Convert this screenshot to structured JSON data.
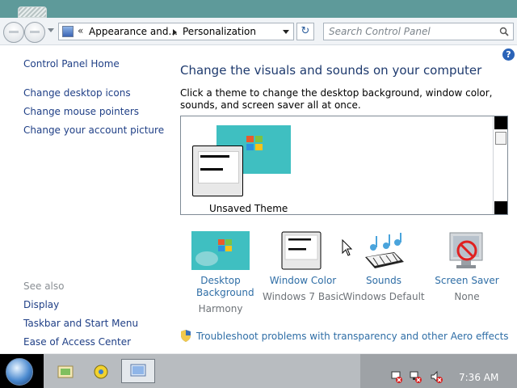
{
  "nav": {
    "breadcrumb_prefix": "«",
    "breadcrumb_1": "Appearance and...",
    "breadcrumb_2": "Personalization",
    "search_placeholder": "Search Control Panel",
    "refresh_glyph": "↻"
  },
  "help": {
    "glyph": "?"
  },
  "sidebar": {
    "home": "Control Panel Home",
    "links": [
      "Change desktop icons",
      "Change mouse pointers",
      "Change your account picture"
    ],
    "see_also_label": "See also",
    "see_also": [
      "Display",
      "Taskbar and Start Menu",
      "Ease of Access Center"
    ]
  },
  "main": {
    "title": "Change the visuals and sounds on your computer",
    "description": "Click a theme to change the desktop background, window color, sounds, and screen saver all at once.",
    "theme_label": "Unsaved Theme",
    "settings": [
      {
        "label": "Desktop Background",
        "value": "Harmony",
        "icon": "desktop-background-icon"
      },
      {
        "label": "Window Color",
        "value": "Windows 7 Basic",
        "icon": "window-color-icon"
      },
      {
        "label": "Sounds",
        "value": "Windows Default",
        "icon": "sounds-icon"
      },
      {
        "label": "Screen Saver",
        "value": "None",
        "icon": "screen-saver-icon"
      }
    ],
    "troubleshoot": "Troubleshoot problems with transparency and other Aero effects"
  },
  "taskbar": {
    "clock": "7:36 AM"
  },
  "colors": {
    "link": "#1f3f86",
    "title": "#1e3a6e",
    "wallpaper": "#3fbfc1",
    "taskbar": "#b8bcc0"
  }
}
